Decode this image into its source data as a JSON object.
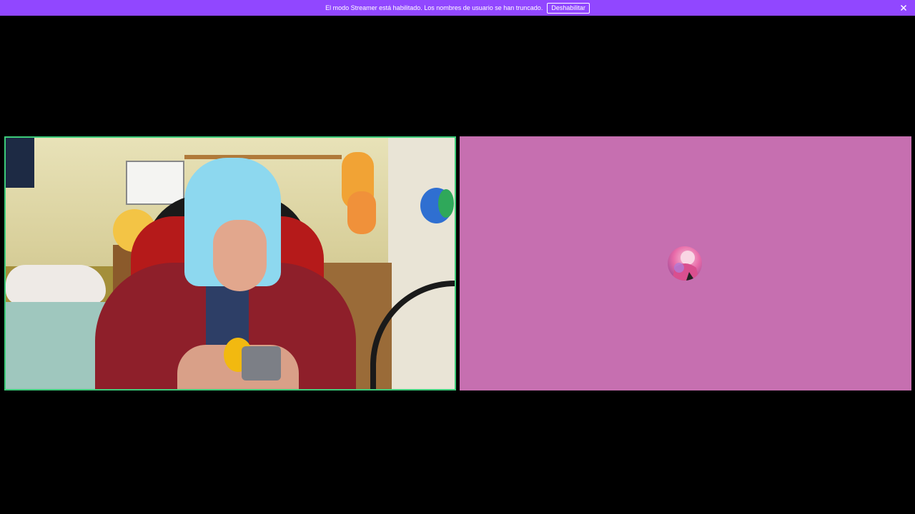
{
  "banner": {
    "message": "El modo Streamer está habilitado. Los nombres de usuario se han truncado.",
    "disable_button": "Deshabilitar",
    "close_icon": "close-icon",
    "background_color": "#9147ff"
  },
  "participants": [
    {
      "tile": "camera-video",
      "speaking": true,
      "speaking_border_color": "#3dcc7a"
    },
    {
      "tile": "avatar-only",
      "background_color": "#c66fb0",
      "avatar_icon": "user-avatar"
    }
  ]
}
